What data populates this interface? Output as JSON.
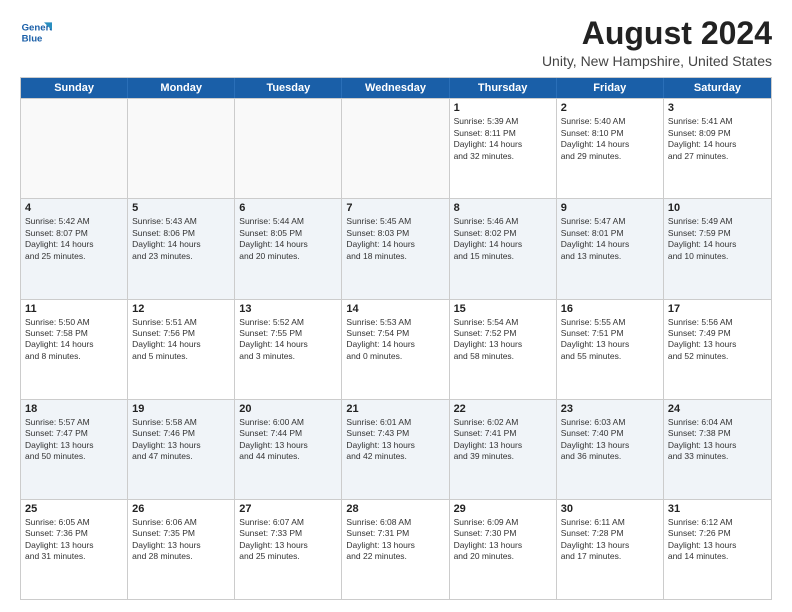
{
  "logo": {
    "line1": "General",
    "line2": "Blue"
  },
  "title": "August 2024",
  "subtitle": "Unity, New Hampshire, United States",
  "header_days": [
    "Sunday",
    "Monday",
    "Tuesday",
    "Wednesday",
    "Thursday",
    "Friday",
    "Saturday"
  ],
  "rows": [
    {
      "alt": false,
      "cells": [
        {
          "day": "",
          "text": "",
          "empty": true
        },
        {
          "day": "",
          "text": "",
          "empty": true
        },
        {
          "day": "",
          "text": "",
          "empty": true
        },
        {
          "day": "",
          "text": "",
          "empty": true
        },
        {
          "day": "1",
          "text": "Sunrise: 5:39 AM\nSunset: 8:11 PM\nDaylight: 14 hours\nand 32 minutes."
        },
        {
          "day": "2",
          "text": "Sunrise: 5:40 AM\nSunset: 8:10 PM\nDaylight: 14 hours\nand 29 minutes."
        },
        {
          "day": "3",
          "text": "Sunrise: 5:41 AM\nSunset: 8:09 PM\nDaylight: 14 hours\nand 27 minutes."
        }
      ]
    },
    {
      "alt": true,
      "cells": [
        {
          "day": "4",
          "text": "Sunrise: 5:42 AM\nSunset: 8:07 PM\nDaylight: 14 hours\nand 25 minutes."
        },
        {
          "day": "5",
          "text": "Sunrise: 5:43 AM\nSunset: 8:06 PM\nDaylight: 14 hours\nand 23 minutes."
        },
        {
          "day": "6",
          "text": "Sunrise: 5:44 AM\nSunset: 8:05 PM\nDaylight: 14 hours\nand 20 minutes."
        },
        {
          "day": "7",
          "text": "Sunrise: 5:45 AM\nSunset: 8:03 PM\nDaylight: 14 hours\nand 18 minutes."
        },
        {
          "day": "8",
          "text": "Sunrise: 5:46 AM\nSunset: 8:02 PM\nDaylight: 14 hours\nand 15 minutes."
        },
        {
          "day": "9",
          "text": "Sunrise: 5:47 AM\nSunset: 8:01 PM\nDaylight: 14 hours\nand 13 minutes."
        },
        {
          "day": "10",
          "text": "Sunrise: 5:49 AM\nSunset: 7:59 PM\nDaylight: 14 hours\nand 10 minutes."
        }
      ]
    },
    {
      "alt": false,
      "cells": [
        {
          "day": "11",
          "text": "Sunrise: 5:50 AM\nSunset: 7:58 PM\nDaylight: 14 hours\nand 8 minutes."
        },
        {
          "day": "12",
          "text": "Sunrise: 5:51 AM\nSunset: 7:56 PM\nDaylight: 14 hours\nand 5 minutes."
        },
        {
          "day": "13",
          "text": "Sunrise: 5:52 AM\nSunset: 7:55 PM\nDaylight: 14 hours\nand 3 minutes."
        },
        {
          "day": "14",
          "text": "Sunrise: 5:53 AM\nSunset: 7:54 PM\nDaylight: 14 hours\nand 0 minutes."
        },
        {
          "day": "15",
          "text": "Sunrise: 5:54 AM\nSunset: 7:52 PM\nDaylight: 13 hours\nand 58 minutes."
        },
        {
          "day": "16",
          "text": "Sunrise: 5:55 AM\nSunset: 7:51 PM\nDaylight: 13 hours\nand 55 minutes."
        },
        {
          "day": "17",
          "text": "Sunrise: 5:56 AM\nSunset: 7:49 PM\nDaylight: 13 hours\nand 52 minutes."
        }
      ]
    },
    {
      "alt": true,
      "cells": [
        {
          "day": "18",
          "text": "Sunrise: 5:57 AM\nSunset: 7:47 PM\nDaylight: 13 hours\nand 50 minutes."
        },
        {
          "day": "19",
          "text": "Sunrise: 5:58 AM\nSunset: 7:46 PM\nDaylight: 13 hours\nand 47 minutes."
        },
        {
          "day": "20",
          "text": "Sunrise: 6:00 AM\nSunset: 7:44 PM\nDaylight: 13 hours\nand 44 minutes."
        },
        {
          "day": "21",
          "text": "Sunrise: 6:01 AM\nSunset: 7:43 PM\nDaylight: 13 hours\nand 42 minutes."
        },
        {
          "day": "22",
          "text": "Sunrise: 6:02 AM\nSunset: 7:41 PM\nDaylight: 13 hours\nand 39 minutes."
        },
        {
          "day": "23",
          "text": "Sunrise: 6:03 AM\nSunset: 7:40 PM\nDaylight: 13 hours\nand 36 minutes."
        },
        {
          "day": "24",
          "text": "Sunrise: 6:04 AM\nSunset: 7:38 PM\nDaylight: 13 hours\nand 33 minutes."
        }
      ]
    },
    {
      "alt": false,
      "cells": [
        {
          "day": "25",
          "text": "Sunrise: 6:05 AM\nSunset: 7:36 PM\nDaylight: 13 hours\nand 31 minutes."
        },
        {
          "day": "26",
          "text": "Sunrise: 6:06 AM\nSunset: 7:35 PM\nDaylight: 13 hours\nand 28 minutes."
        },
        {
          "day": "27",
          "text": "Sunrise: 6:07 AM\nSunset: 7:33 PM\nDaylight: 13 hours\nand 25 minutes."
        },
        {
          "day": "28",
          "text": "Sunrise: 6:08 AM\nSunset: 7:31 PM\nDaylight: 13 hours\nand 22 minutes."
        },
        {
          "day": "29",
          "text": "Sunrise: 6:09 AM\nSunset: 7:30 PM\nDaylight: 13 hours\nand 20 minutes."
        },
        {
          "day": "30",
          "text": "Sunrise: 6:11 AM\nSunset: 7:28 PM\nDaylight: 13 hours\nand 17 minutes."
        },
        {
          "day": "31",
          "text": "Sunrise: 6:12 AM\nSunset: 7:26 PM\nDaylight: 13 hours\nand 14 minutes."
        }
      ]
    }
  ]
}
